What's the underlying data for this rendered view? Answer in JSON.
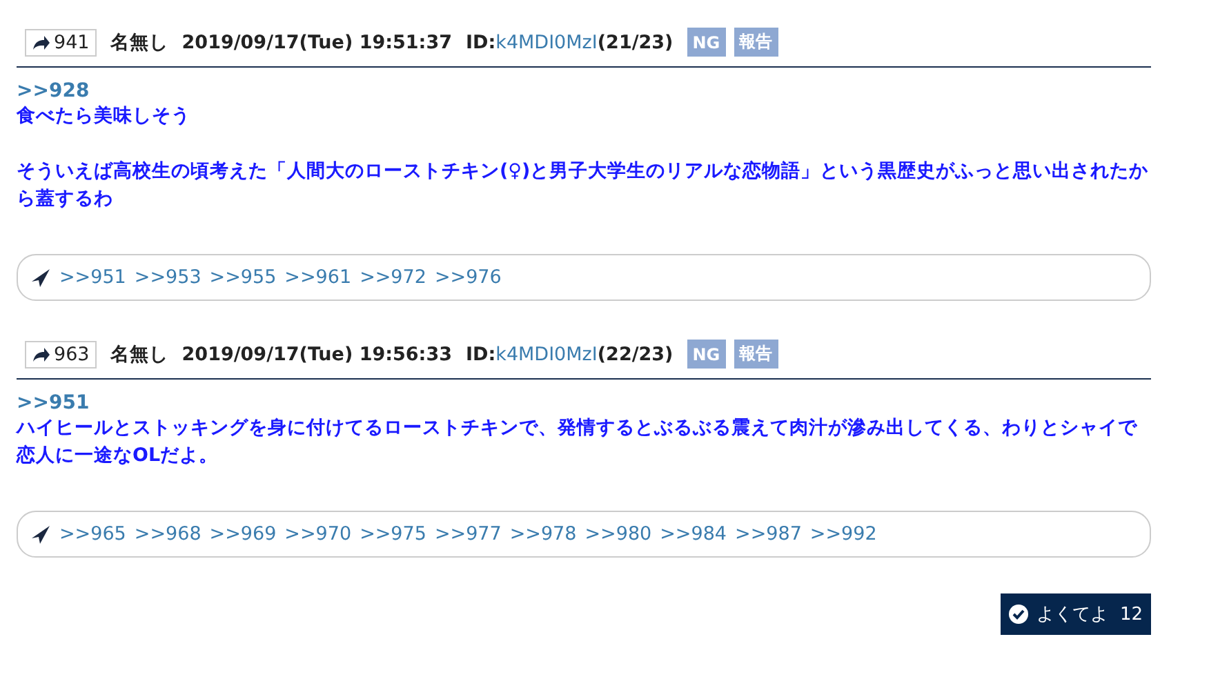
{
  "posts": [
    {
      "number": "941",
      "name": "名無し",
      "datetime": "2019/09/17(Tue) 19:51:37",
      "id_label": "ID:",
      "id": "k4MDI0MzI",
      "id_count": "(21/23)",
      "buttons": [
        "NG",
        "報告"
      ],
      "quote": ">>928",
      "paragraphs": [
        "食べたら美味しそう",
        "そういえば高校生の頃考えた「人間大のローストチキン(♀)と男子大学生のリアルな恋物語」という黒歴史がふっと思い出されたから蓋するわ"
      ],
      "replies": [
        ">>951",
        ">>953",
        ">>955",
        ">>961",
        ">>972",
        ">>976"
      ]
    },
    {
      "number": "963",
      "name": "名無し",
      "datetime": "2019/09/17(Tue) 19:56:33",
      "id_label": "ID:",
      "id": "k4MDI0MzI",
      "id_count": "(22/23)",
      "buttons": [
        "NG",
        "報告"
      ],
      "quote": ">>951",
      "paragraphs": [
        "ハイヒールとストッキングを身に付けてるローストチキンで、発情するとぶるぶる震えて肉汁が滲み出してくる、わりとシャイで恋人に一途なOLだよ。"
      ],
      "replies": [
        ">>965",
        ">>968",
        ">>969",
        ">>970",
        ">>975",
        ">>977",
        ">>978",
        ">>980",
        ">>984",
        ">>987",
        ">>992"
      ]
    }
  ],
  "like": {
    "label": "よくてよ",
    "count": "12"
  }
}
